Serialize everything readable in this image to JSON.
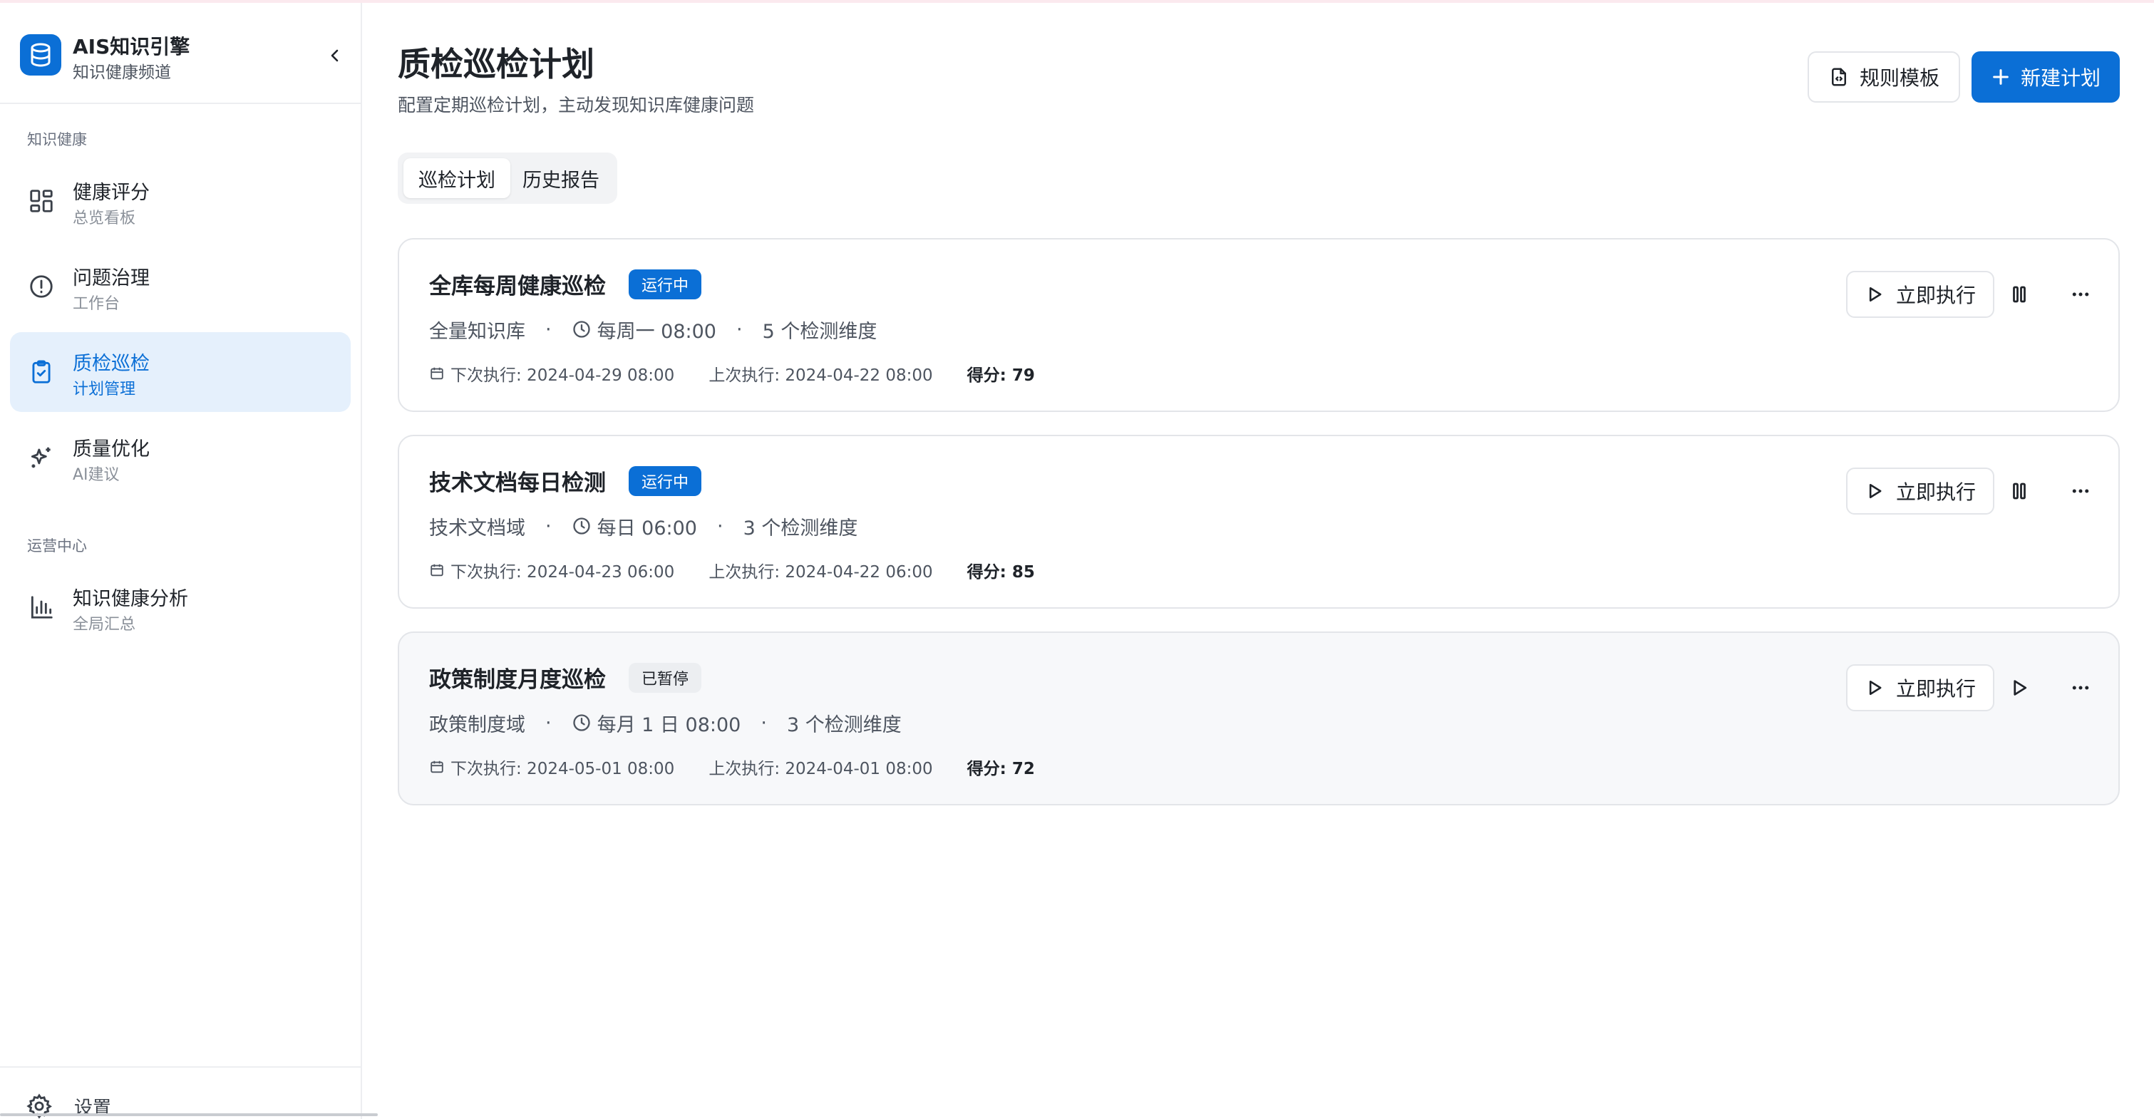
{
  "brand": {
    "title": "AIS知识引擎",
    "subtitle": "知识健康频道"
  },
  "sidebar": {
    "sections": [
      {
        "label": "知识健康"
      },
      {
        "label": "运营中心"
      }
    ],
    "items": [
      {
        "title": "健康评分",
        "subtitle": "总览看板",
        "icon": "grid-icon"
      },
      {
        "title": "问题治理",
        "subtitle": "工作台",
        "icon": "alert-circle-icon"
      },
      {
        "title": "质检巡检",
        "subtitle": "计划管理",
        "icon": "clipboard-check-icon",
        "active": true
      },
      {
        "title": "质量优化",
        "subtitle": "AI建议",
        "icon": "sparkles-icon"
      },
      {
        "title": "知识健康分析",
        "subtitle": "全局汇总",
        "icon": "bar-chart-icon"
      }
    ],
    "settings_label": "设置"
  },
  "page": {
    "title": "质检巡检计划",
    "subtitle": "配置定期巡检计划，主动发现知识库健康问题",
    "template_button": "规则模板",
    "new_button": "新建计划"
  },
  "tabs": [
    {
      "label": "巡检计划",
      "active": true
    },
    {
      "label": "历史报告",
      "active": false
    }
  ],
  "plans": [
    {
      "name": "全库每周健康巡检",
      "status": "运行中",
      "scope": "全量知识库",
      "schedule": "每周一 08:00",
      "dimensions": "5 个检测维度",
      "next_run": "下次执行: 2024-04-29 08:00",
      "last_run": "上次执行: 2024-04-22 08:00",
      "score": "得分: 79",
      "run_label": "立即执行"
    },
    {
      "name": "技术文档每日检测",
      "status": "运行中",
      "scope": "技术文档域",
      "schedule": "每日 06:00",
      "dimensions": "3 个检测维度",
      "next_run": "下次执行: 2024-04-23 06:00",
      "last_run": "上次执行: 2024-04-22 06:00",
      "score": "得分: 85",
      "run_label": "立即执行"
    },
    {
      "name": "政策制度月度巡检",
      "status": "已暂停",
      "scope": "政策制度域",
      "schedule": "每月 1 日 08:00",
      "dimensions": "3 个检测维度",
      "next_run": "下次执行: 2024-05-01 08:00",
      "last_run": "上次执行: 2024-04-01 08:00",
      "score": "得分: 72",
      "run_label": "立即执行"
    }
  ],
  "colors": {
    "accent": "#0b6fd6",
    "active_bg": "#e5f0fc",
    "text": "#1f2329",
    "muted": "#4e5560"
  },
  "separator": "·"
}
